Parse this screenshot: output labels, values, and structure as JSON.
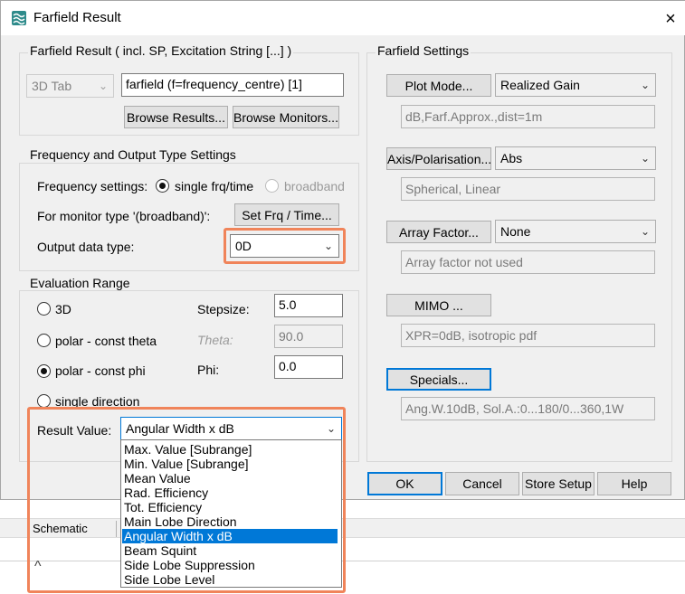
{
  "window": {
    "title": "Farfield Result",
    "close_icon": "×"
  },
  "result_group": {
    "title": "Farfield Result ( incl. SP, Excitation String [...] )",
    "tab_combo": "3D Tab",
    "result_field": "farfield (f=frequency_centre) [1]",
    "browse_results": "Browse Results...",
    "browse_monitors": "Browse Monitors..."
  },
  "frequency_group": {
    "title": "Frequency and Output Type Settings",
    "freq_label": "Frequency settings:",
    "single_label": "single frq/time",
    "broadband_label": "broadband",
    "monitor_label": "For monitor type '(broadband)':",
    "set_frq_button": "Set Frq / Time...",
    "output_label": "Output data type:",
    "output_value": "0D"
  },
  "evaluation_group": {
    "title": "Evaluation Range",
    "opt_3d": "3D",
    "opt_theta": "polar - const theta",
    "opt_phi": "polar - const phi",
    "opt_single": "single direction",
    "stepsize_label": "Stepsize:",
    "stepsize_value": "5.0",
    "theta_label": "Theta:",
    "theta_value": "90.0",
    "phi_label": "Phi:",
    "phi_value": "0.0",
    "result_value_label": "Result Value:",
    "result_value": "Angular Width x dB",
    "options": [
      "Max. Value [Subrange]",
      "Min. Value [Subrange]",
      "Mean Value",
      "Rad. Efficiency",
      "Tot. Efficiency",
      "Main Lobe Direction",
      "Angular Width x dB",
      "Beam Squint",
      "Side Lobe Suppression",
      "Side Lobe Level"
    ]
  },
  "settings_group": {
    "title": "Farfield Settings",
    "plot_mode_button": "Plot Mode...",
    "plot_mode_value": "Realized Gain",
    "plot_mode_info": "dB,Farf.Approx.,dist=1m",
    "axis_button": "Axis/Polarisation...",
    "axis_value": "Abs",
    "axis_info": "Spherical, Linear",
    "array_button": "Array Factor...",
    "array_value": "None",
    "array_info": "Array factor not used",
    "mimo_button": "MIMO ...",
    "mimo_info": "XPR=0dB, isotropic pdf",
    "specials_button": "Specials...",
    "specials_info": "Ang.W.10dB, Sol.A.:0...180/0...360,1W"
  },
  "footer": {
    "ok": "OK",
    "cancel": "Cancel",
    "store": "Store Setup",
    "help": "Help"
  },
  "background": {
    "tab_label": "Schematic",
    "chevron": "^"
  },
  "colors": {
    "accent": "#0078d7",
    "highlight": "#f0845a"
  }
}
